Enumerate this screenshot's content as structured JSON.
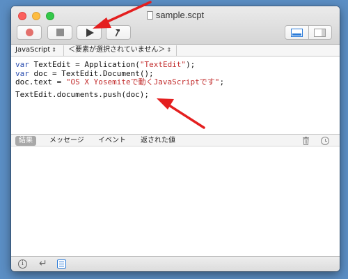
{
  "window": {
    "title": "sample.scpt"
  },
  "toolbar": {
    "record_icon": "record-icon",
    "stop_icon": "stop-icon",
    "run_icon": "run-icon",
    "compile_icon": "hammer-icon",
    "view_icons": [
      "editor-only-icon",
      "sidebar-icon"
    ]
  },
  "navbar": {
    "language": "JavaScript",
    "handler": "＜要素が選択されていません＞"
  },
  "editor": {
    "lines": [
      {
        "kw": "var",
        "code": " TextEdit = Application(",
        "str": "\"TextEdit\"",
        "tail": ");"
      },
      {
        "kw": "var",
        "code": " doc = TextEdit.Document();",
        "str": "",
        "tail": ""
      },
      {
        "kw": "",
        "code": "doc.text = ",
        "str": "\"OS X Yosemiteで動くJavaScriptです\"",
        "tail": ";"
      },
      {
        "kw": "",
        "code": "TextEdit.documents.push(doc);",
        "str": "",
        "tail": ""
      }
    ]
  },
  "results": {
    "tabs": [
      "結果",
      "メッセージ",
      "イベント",
      "返された値"
    ],
    "active_tab": "結果"
  },
  "colors": {
    "keyword": "#2c4fb0",
    "string": "#c22d2d",
    "annotation_arrow": "#e41f1f",
    "desktop": "#5b8ec4"
  }
}
